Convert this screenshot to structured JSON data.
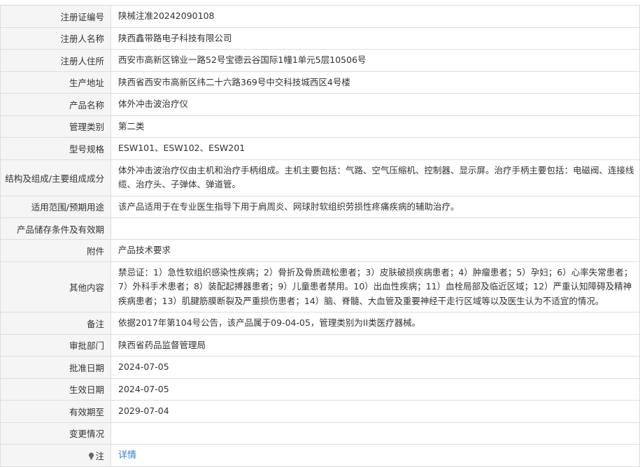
{
  "rows": [
    {
      "label": "注册证编号",
      "value": "陕械注准20242090108"
    },
    {
      "label": "注册人名称",
      "value": "陕西鑫带路电子科技有限公司"
    },
    {
      "label": "注册人住所",
      "value": "西安市高新区锦业一路52号宝德云谷国际1幢1单元5层10506号"
    },
    {
      "label": "生产地址",
      "value": "陕西省西安市高新区纬二十六路369号中交科技城西区4号楼"
    },
    {
      "label": "产品名称",
      "value": "体外冲击波治疗仪"
    },
    {
      "label": "管理类别",
      "value": "第二类"
    },
    {
      "label": "型号规格",
      "value": "ESW101、ESW102、ESW201"
    },
    {
      "label": "结构及组成/主要组成成分",
      "value": "体外冲击波治疗仪由主机和治疗手柄组成。主机主要包括：气路、空气压缩机、控制器、显示屏。治疗手柄主要包括：电磁阀、连接线缆、治疗头、子弹体、弹道管。"
    },
    {
      "label": "适用范围/预期用途",
      "value": "该产品适用于在专业医生指导下用于肩周炎、网球肘软组织劳损性疼痛疾病的辅助治疗。"
    },
    {
      "label": "产品储存条件及有效期",
      "value": ""
    },
    {
      "label": "附件",
      "value": "产品技术要求"
    },
    {
      "label": "其他内容",
      "value": "禁忌证：1）急性软组织感染性疾病；2）骨折及骨质疏松患者；3）皮肤破损疾病患者；4）肿瘤患者；5）孕妇；6）心率失常患者；7）外科手术患者；8）装配起搏器患者；9）儿童患者禁用。10）出血性疾病；11）血栓局部及临近区域；12）严重认知障碍及精神疾病患者；13）肌腱筋膜断裂及严重损伤患者；14）脑、脊髓、大血管及重要神经干走行区域等以及医生认为不适宜的情况。"
    },
    {
      "label": "备注",
      "value": "依据2017年第104号公告，该产品属于09-04-05，管理类别为II类医疗器械。"
    },
    {
      "label": "审批部门",
      "value": "陕西省药品监督管理局"
    },
    {
      "label": "批准日期",
      "value": "2024-07-05"
    },
    {
      "label": "生效日期",
      "value": "2024-07-05"
    },
    {
      "label": "有效期至",
      "value": "2029-07-04"
    },
    {
      "label": "变更情况",
      "value": ""
    }
  ],
  "note": {
    "label": "注",
    "link_text": "详情"
  },
  "icons": {
    "note_icon": "lightbulb-icon"
  },
  "colors": {
    "link": "#2f7fd2",
    "label_bg": "#f5f5f5",
    "border": "#dddddd"
  }
}
